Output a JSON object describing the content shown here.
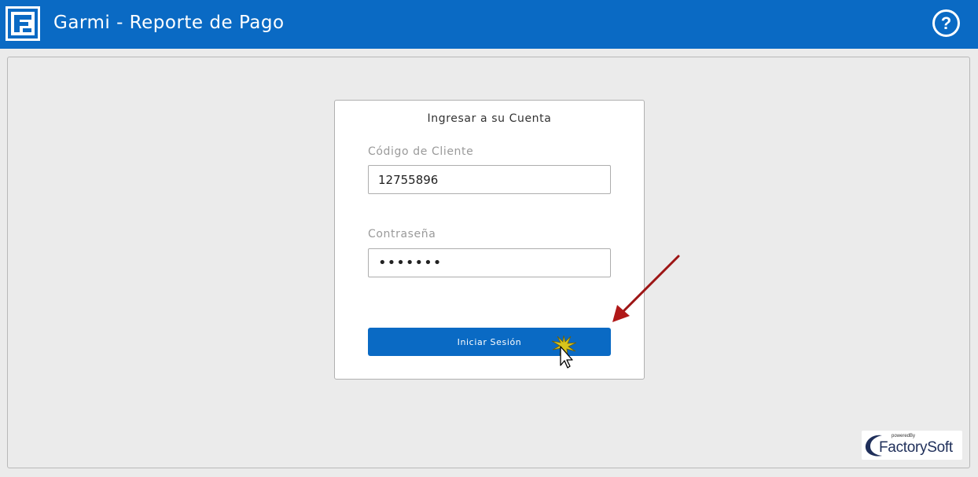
{
  "header": {
    "app_title": "Garmi - Reporte de Pago",
    "help_symbol": "?",
    "logo_icon": "factorysoft-f-logo-icon",
    "help_icon": "help-circle-icon"
  },
  "login": {
    "title": "Ingresar a su Cuenta",
    "client_code_label": "Código de Cliente",
    "client_code_value": "12755896",
    "password_label": "Contraseña",
    "password_value": "•••••••",
    "submit_label": "Iniciar Sesión"
  },
  "footer": {
    "powered_by": "poweredBy",
    "brand": "FactorySoft"
  },
  "colors": {
    "header_bg": "#0a6ac4",
    "button_bg": "#0a6ac4",
    "panel_bg": "#ebebeb",
    "annotation_arrow": "#b01818"
  }
}
